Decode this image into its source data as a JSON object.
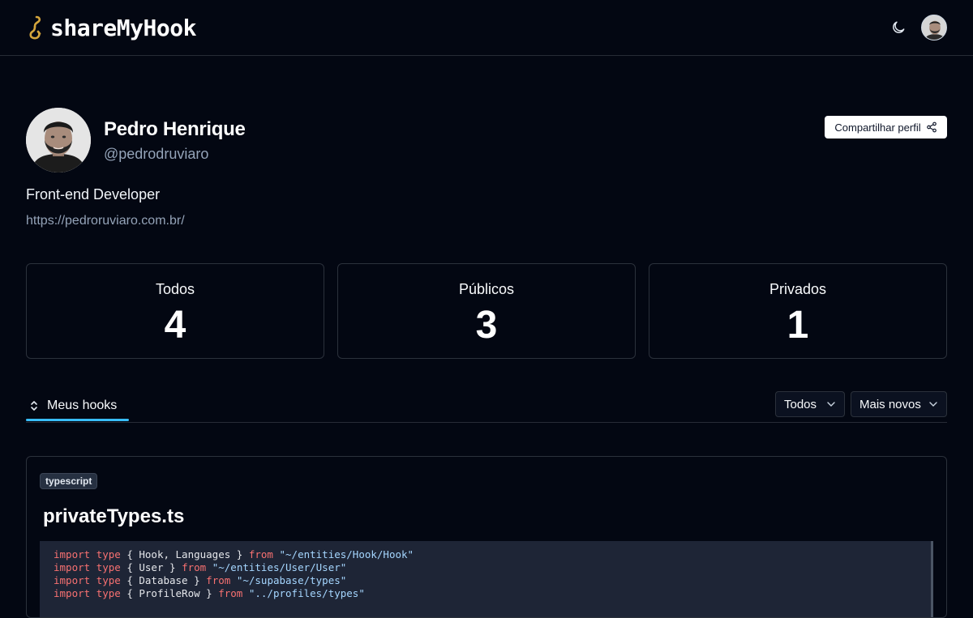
{
  "header": {
    "brand": "shareMyHook",
    "theme_toggle_icon": "moon-icon",
    "colors": {
      "background": "#030712",
      "accent": "#38bdf8",
      "brand_gold": "#d4a53c"
    }
  },
  "profile": {
    "name": "Pedro Henrique",
    "handle": "@pedrodruviaro",
    "bio": "Front-end Developer",
    "website": "https://pedroruviaro.com.br/",
    "share_label": "Compartilhar perfil"
  },
  "stats": [
    {
      "label": "Todos",
      "value": "4"
    },
    {
      "label": "Públicos",
      "value": "3"
    },
    {
      "label": "Privados",
      "value": "1"
    }
  ],
  "tabs": [
    {
      "label": "Meus hooks",
      "icon": "chevrons-up-down-icon",
      "active": true
    }
  ],
  "filters": {
    "visibility": "Todos",
    "sort": "Mais novos"
  },
  "hooks": [
    {
      "language": "typescript",
      "title": "privateTypes.ts",
      "code": [
        {
          "kw1": "import",
          "kw2": "type",
          "names": "{ Hook, Languages }",
          "kw3": "from",
          "path": "\"~/entities/Hook/Hook\""
        },
        {
          "kw1": "import",
          "kw2": "type",
          "names": "{ User }",
          "kw3": "from",
          "path": "\"~/entities/User/User\""
        },
        {
          "kw1": "import",
          "kw2": "type",
          "names": "{ Database }",
          "kw3": "from",
          "path": "\"~/supabase/types\""
        },
        {
          "kw1": "import",
          "kw2": "type",
          "names": "{ ProfileRow }",
          "kw3": "from",
          "path": "\"../profiles/types\""
        }
      ]
    }
  ]
}
